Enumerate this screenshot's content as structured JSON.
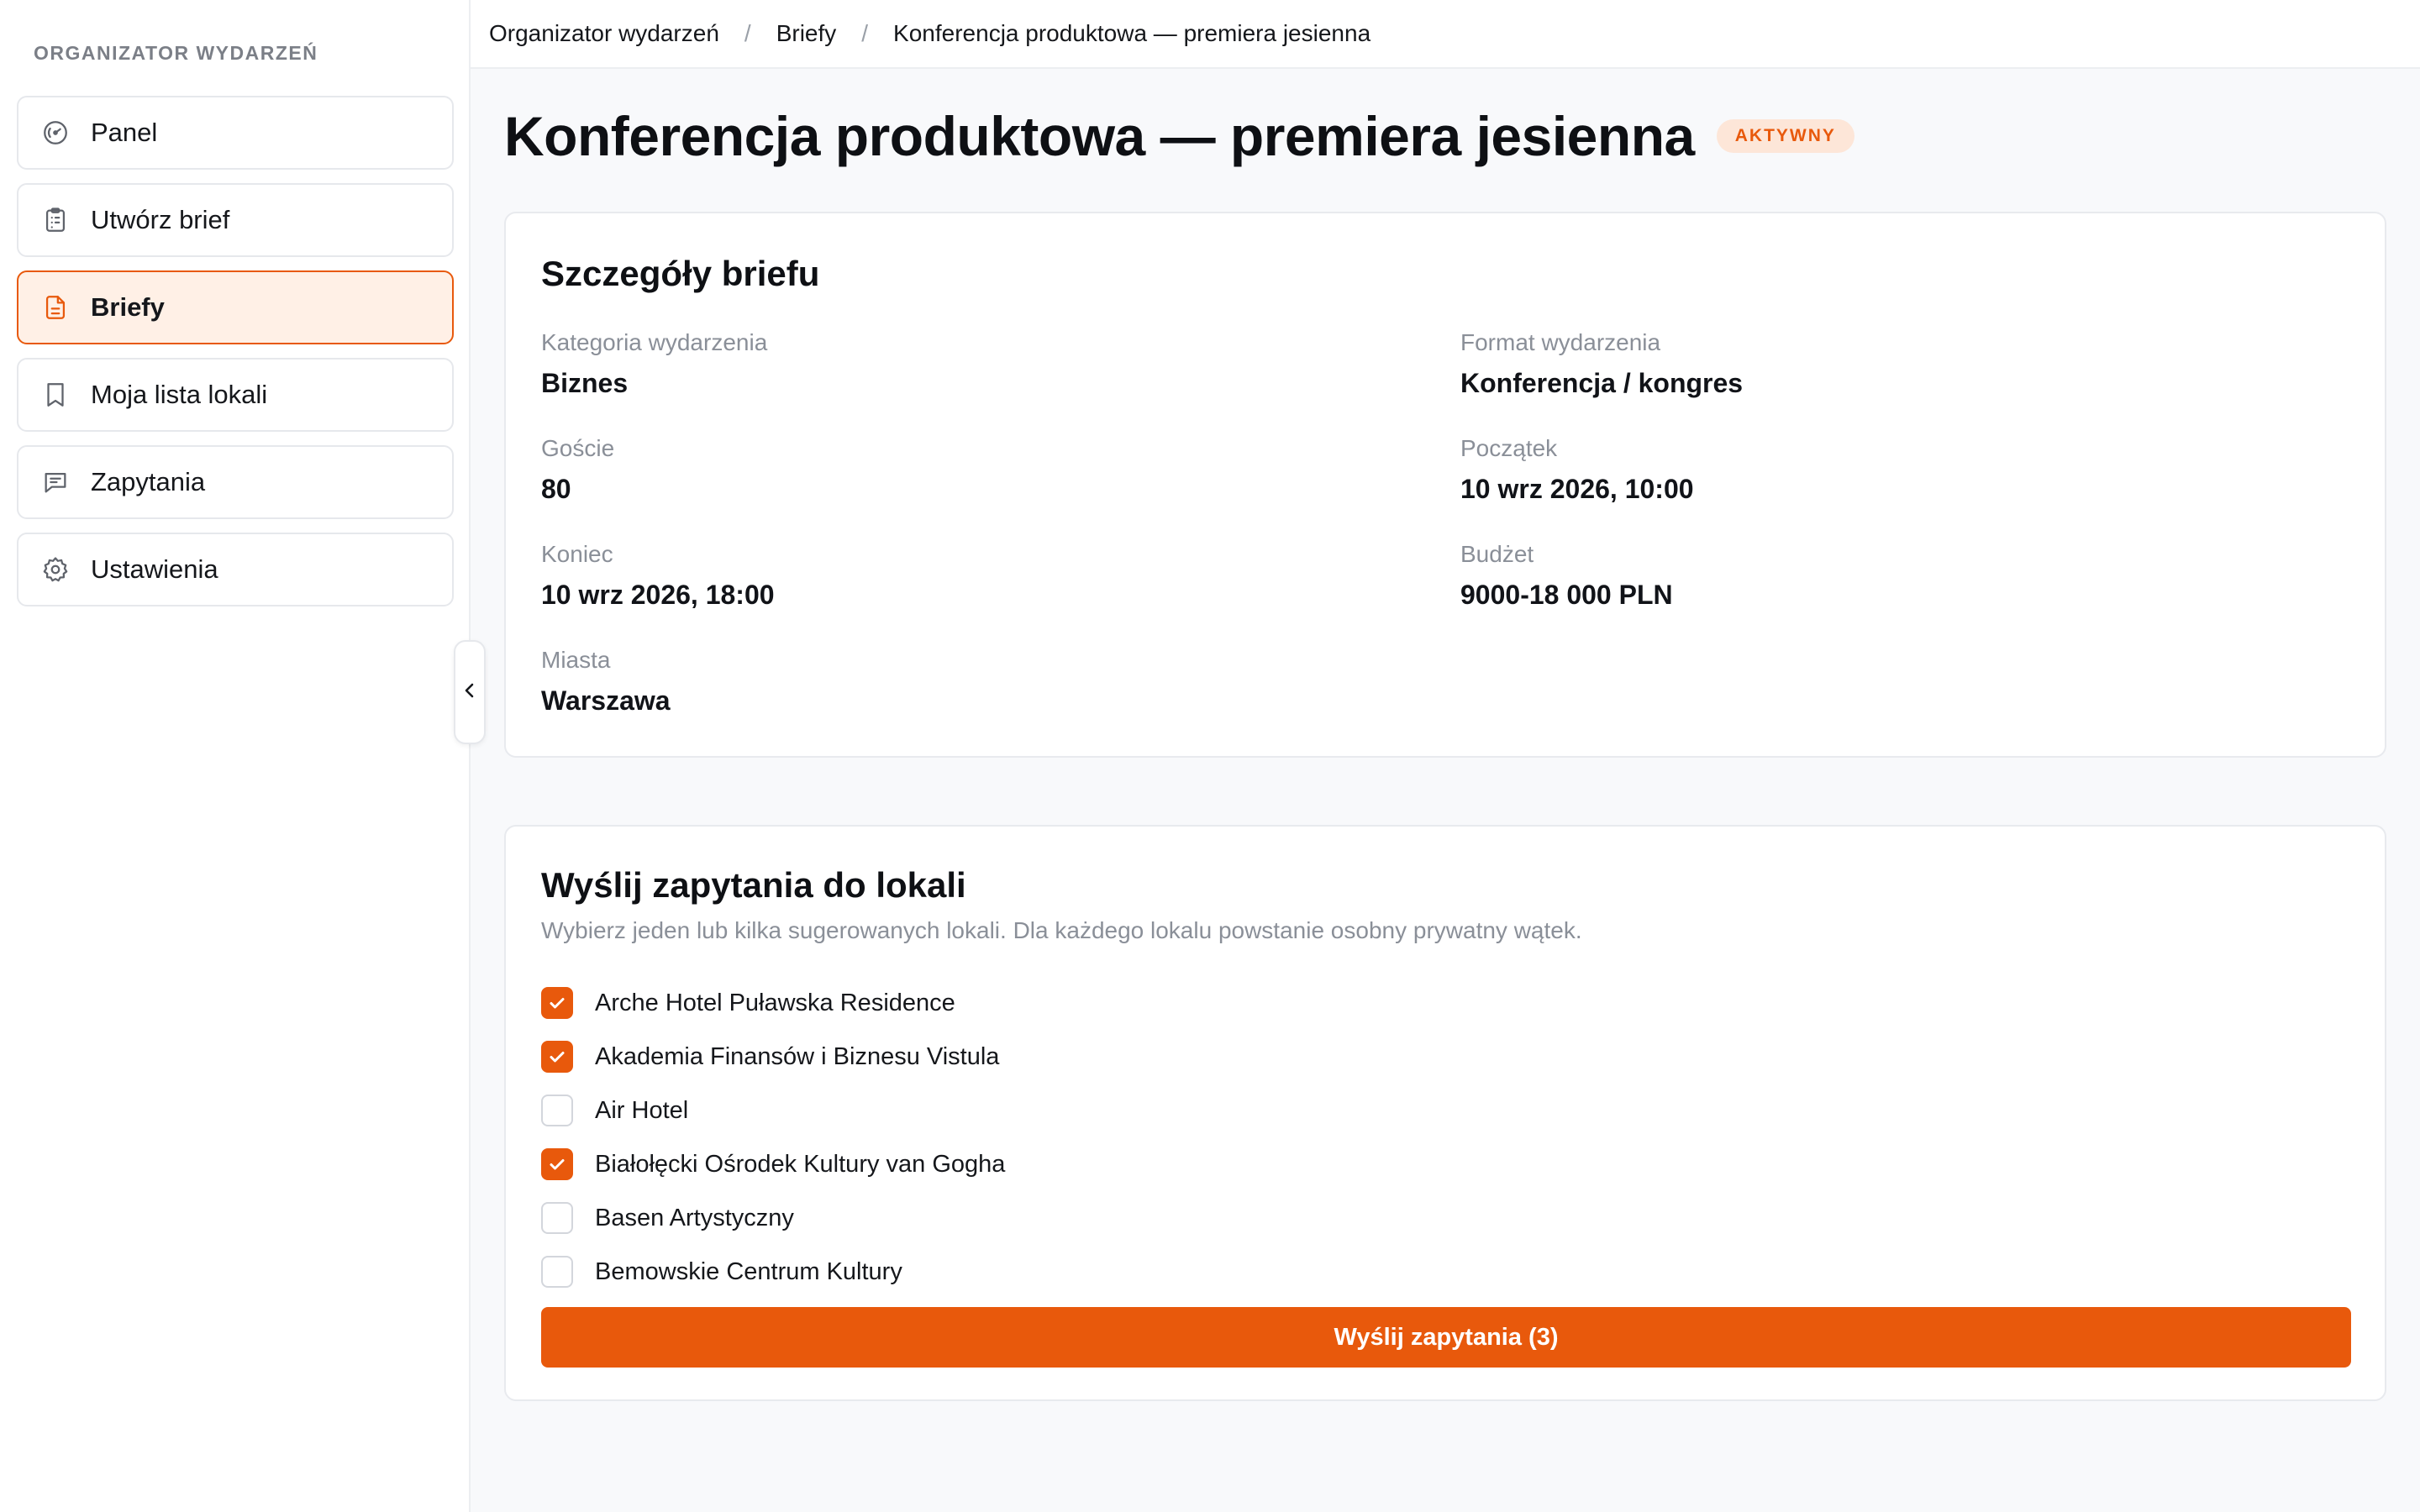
{
  "sidebar": {
    "heading": "ORGANIZATOR WYDARZEŃ",
    "items": [
      {
        "label": "Panel",
        "icon": "gauge-icon"
      },
      {
        "label": "Utwórz brief",
        "icon": "clipboard-icon"
      },
      {
        "label": "Briefy",
        "icon": "document-icon",
        "active": true
      },
      {
        "label": "Moja lista lokali",
        "icon": "bookmark-icon"
      },
      {
        "label": "Zapytania",
        "icon": "message-icon"
      },
      {
        "label": "Ustawienia",
        "icon": "gear-icon"
      }
    ]
  },
  "breadcrumb": {
    "items": [
      "Organizator wydarzeń",
      "Briefy",
      "Konferencja produktowa — premiera jesienna"
    ],
    "separator": "/"
  },
  "page": {
    "title": "Konferencja produktowa — premiera jesienna",
    "status": "AKTYWNY"
  },
  "details": {
    "title": "Szczegóły briefu",
    "fields": [
      {
        "label": "Kategoria wydarzenia",
        "value": "Biznes"
      },
      {
        "label": "Format wydarzenia",
        "value": "Konferencja / kongres"
      },
      {
        "label": "Goście",
        "value": "80"
      },
      {
        "label": "Początek",
        "value": "10 wrz 2026, 10:00"
      },
      {
        "label": "Koniec",
        "value": "10 wrz 2026, 18:00"
      },
      {
        "label": "Budżet",
        "value": "9000-18 000 PLN"
      },
      {
        "label": "Miasta",
        "value": "Warszawa"
      }
    ]
  },
  "inquiries": {
    "title": "Wyślij zapytania do lokali",
    "description": "Wybierz jeden lub kilka sugerowanych lokali. Dla każdego lokalu powstanie osobny prywatny wątek.",
    "venues": [
      {
        "name": "Arche Hotel Puławska Residence",
        "checked": true
      },
      {
        "name": "Akademia Finansów i Biznesu Vistula",
        "checked": true
      },
      {
        "name": "Air Hotel",
        "checked": false
      },
      {
        "name": "Białołęcki Ośrodek Kultury van Gogha",
        "checked": true
      },
      {
        "name": "Basen Artystyczny",
        "checked": false
      },
      {
        "name": "Bemowskie Centrum Kultury",
        "checked": false
      }
    ],
    "send_label": "Wyślij zapytania (3)"
  },
  "colors": {
    "accent": "#e8590c",
    "accent_light": "#fff0e6",
    "badge_bg": "#fde6d8"
  }
}
